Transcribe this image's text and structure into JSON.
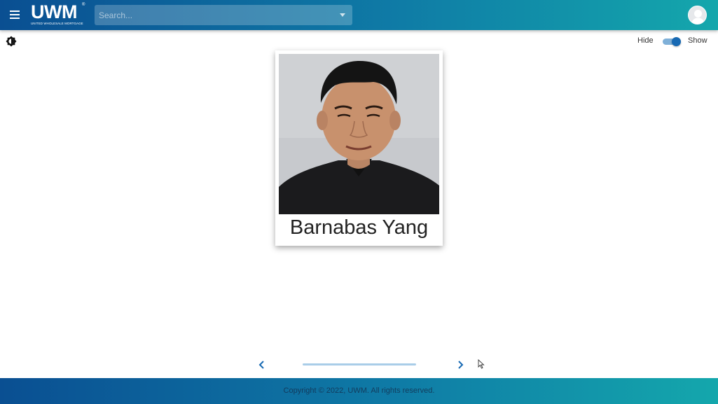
{
  "header": {
    "logo_text": "UWM",
    "logo_subtext": "UNITED WHOLESALE MORTGAGE",
    "search": {
      "placeholder": "Search...",
      "value": ""
    },
    "accent_gradient": [
      "#0a4f92",
      "#14a7ac"
    ]
  },
  "toolbar": {
    "theme_icon": "brightness-icon",
    "toggle": {
      "off_label": "Hide",
      "on_label": "Show",
      "state": "on"
    }
  },
  "profile_card": {
    "name": "Barnabas Yang",
    "photo_icon": "person-photo"
  },
  "carousel": {
    "prev_icon": "chevron-left-icon",
    "next_icon": "chevron-right-icon"
  },
  "footer": {
    "copyright": "Copyright © 2022, UWM. All rights reserved."
  }
}
